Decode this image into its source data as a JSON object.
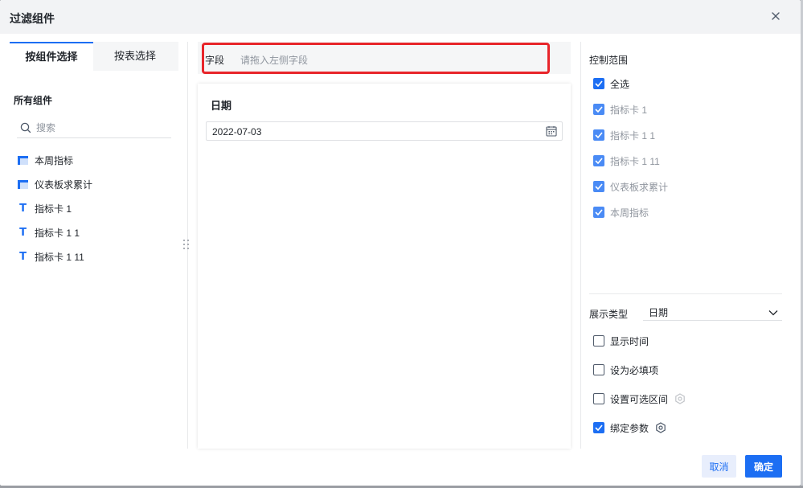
{
  "dialog": {
    "title": "过滤组件",
    "close_icon": "close-icon"
  },
  "left": {
    "tabs": [
      {
        "label": "按组件选择",
        "active": true
      },
      {
        "label": "按表选择",
        "active": false
      }
    ],
    "section_title": "所有组件",
    "search_placeholder": "搜索",
    "components": [
      {
        "label": "本周指标",
        "icon": "table-icon"
      },
      {
        "label": "仪表板求累计",
        "icon": "table-icon"
      },
      {
        "label": "指标卡 1",
        "icon": "text-icon"
      },
      {
        "label": "指标卡 1 1",
        "icon": "text-icon"
      },
      {
        "label": "指标卡 1 11",
        "icon": "text-icon"
      }
    ]
  },
  "middle": {
    "field_label": "字段",
    "field_placeholder": "请拖入左侧字段",
    "highlight_color": "#e8252a",
    "preview_title": "日期",
    "date_value": "2022-07-03"
  },
  "right": {
    "control_range_title": "控制范围",
    "range_items": [
      {
        "label": "全选",
        "checked": true,
        "dim": false
      },
      {
        "label": "指标卡 1",
        "checked": true,
        "dim": true
      },
      {
        "label": "指标卡 1 1",
        "checked": true,
        "dim": true
      },
      {
        "label": "指标卡 1 11",
        "checked": true,
        "dim": true
      },
      {
        "label": "仪表板求累计",
        "checked": true,
        "dim": true
      },
      {
        "label": "本周指标",
        "checked": true,
        "dim": true
      }
    ],
    "display_type_label": "展示类型",
    "display_type_value": "日期",
    "options": [
      {
        "label": "显示时间",
        "checked": false,
        "gear": false
      },
      {
        "label": "设为必填项",
        "checked": false,
        "gear": false
      },
      {
        "label": "设置可选区间",
        "checked": false,
        "gear": true
      },
      {
        "label": "绑定参数",
        "checked": true,
        "gear": true
      }
    ]
  },
  "footer": {
    "cancel_label": "取消",
    "ok_label": "确定"
  },
  "colors": {
    "accent": "#1c6ef3",
    "header_bg": "#f2f3f5",
    "highlight": "#e8252a"
  }
}
